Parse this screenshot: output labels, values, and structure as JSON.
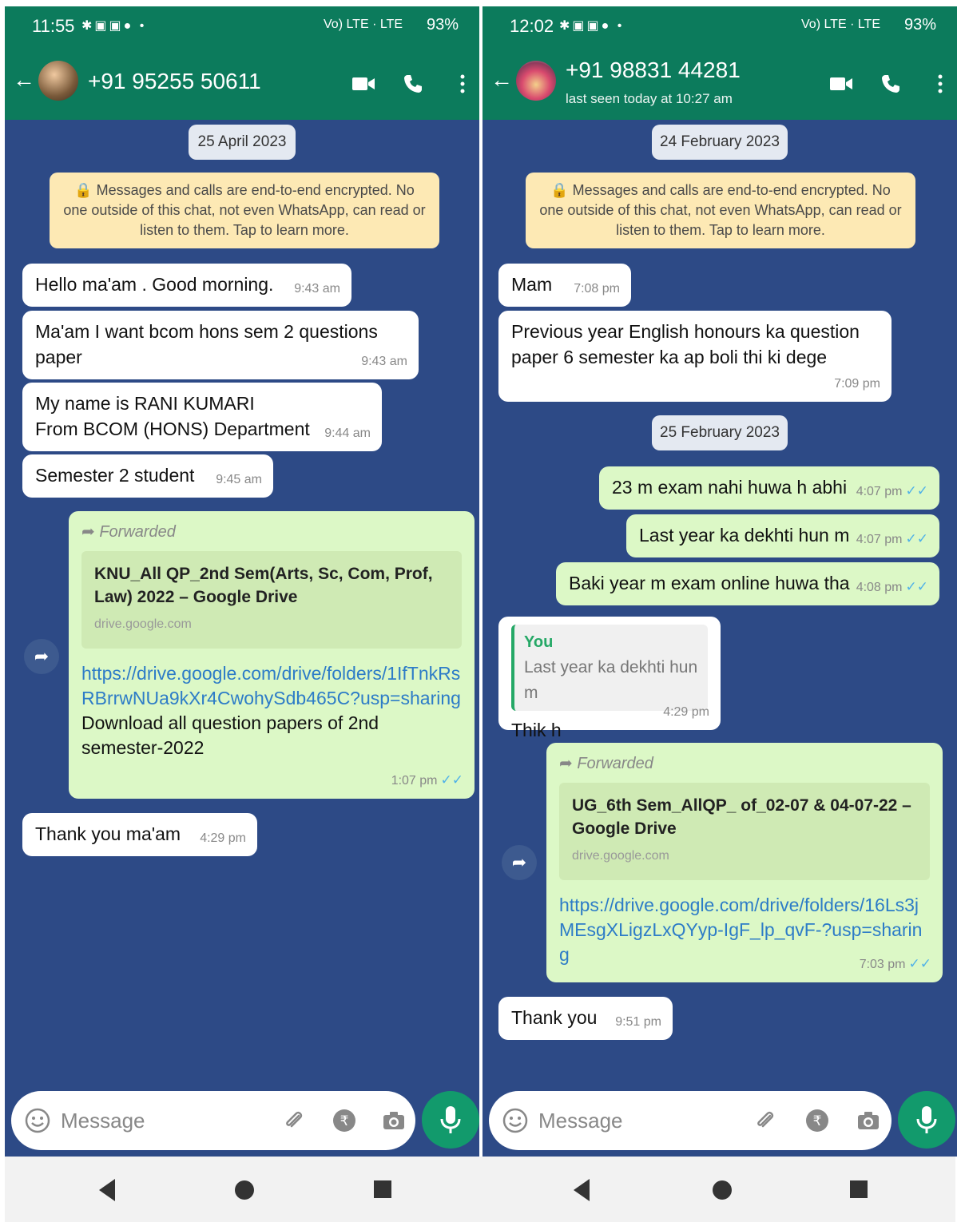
{
  "left": {
    "status": {
      "time": "11:55",
      "net": "Vo) LTE · LTE",
      "battery": "93%"
    },
    "header": {
      "contact": "+91 95255 50611",
      "last_seen": ""
    },
    "date_chip": "25 April 2023",
    "encryption_notice": "🔒 Messages and calls are end-to-end encrypted. No one outside of this chat, not even WhatsApp, can read or listen to them. Tap to learn more.",
    "messages": [
      {
        "text": "Hello ma'am . Good morning.",
        "time": "9:43 am"
      },
      {
        "text": "Ma'am I want bcom hons sem 2 questions\npaper",
        "time": "9:43 am"
      },
      {
        "text": "My name is RANI KUMARI\nFrom BCOM (HONS) Department",
        "time": "9:44 am"
      },
      {
        "text": "Semester 2 student",
        "time": "9:45 am"
      }
    ],
    "forwarded": {
      "label": "Forwarded",
      "link_title": "KNU_All QP_2nd Sem(Arts, Sc, Com, Prof, Law) 2022 – Google Drive",
      "link_domain": "drive.google.com",
      "url": "https://drive.google.com/drive/folders/1IfTnkRsRBrrwNUa9kXr4CwohySdb465C?usp=sharing",
      "description": "Download all question papers of 2nd semester-2022",
      "time": "1:07 pm"
    },
    "last_message": {
      "text": "Thank you ma'am",
      "time": "4:29 pm"
    },
    "input_placeholder": "Message"
  },
  "right": {
    "status": {
      "time": "12:02",
      "net": "Vo) LTE · LTE",
      "battery": "93%"
    },
    "header": {
      "contact": "+91 98831 44281",
      "last_seen": "last seen today at 10:27 am"
    },
    "date_chip_1": "24 February 2023",
    "encryption_notice": "🔒 Messages and calls are end-to-end encrypted. No one outside of this chat, not even WhatsApp, can read or listen to them. Tap to learn more.",
    "messages_1": [
      {
        "text": "Mam",
        "time": "7:08 pm"
      },
      {
        "text": "Previous year English honours ka question\npaper 6 semester ka ap boli thi ki dege",
        "time": "7:09 pm"
      }
    ],
    "date_chip_2": "25 February 2023",
    "sent": [
      {
        "text": "23 m exam nahi huwa h abhi",
        "time": "4:07 pm"
      },
      {
        "text": "Last year ka dekhti hun m",
        "time": "4:07 pm"
      },
      {
        "text": "Baki year m exam online huwa tha",
        "time": "4:08 pm"
      }
    ],
    "reply": {
      "quote_author": "You",
      "quote_text": "Last year ka dekhti hun m",
      "text": "Thik h",
      "time": "4:29 pm"
    },
    "forwarded": {
      "label": "Forwarded",
      "link_title": "UG_6th Sem_AllQP_ of_02-07 & 04-07-22 – Google Drive",
      "link_domain": "drive.google.com",
      "url": "https://drive.google.com/drive/folders/16Ls3jMEsgXLigzLxQYyp-IgF_lp_qvF-?usp=sharing",
      "time": "7:03 pm"
    },
    "last_message": {
      "text": "Thank you",
      "time": "9:51 pm"
    },
    "input_placeholder": "Message"
  },
  "icons": [
    "back-arrow-icon",
    "video-call-icon",
    "voice-call-icon",
    "more-options-icon",
    "lock-icon",
    "forward-icon",
    "share-icon",
    "read-ticks-icon",
    "emoji-icon",
    "attachment-icon",
    "payment-icon",
    "camera-icon",
    "mic-icon",
    "nav-back-icon",
    "nav-home-icon",
    "nav-recents-icon"
  ],
  "colors": {
    "header": "#0c7b5c",
    "chat_bg": "#2d4a86",
    "incoming": "#ffffff",
    "outgoing": "#dcf8c6",
    "encryption": "#fde9b4",
    "mic": "#129a6c",
    "link": "#2d7cc7",
    "ticks": "#4fb1e8"
  }
}
